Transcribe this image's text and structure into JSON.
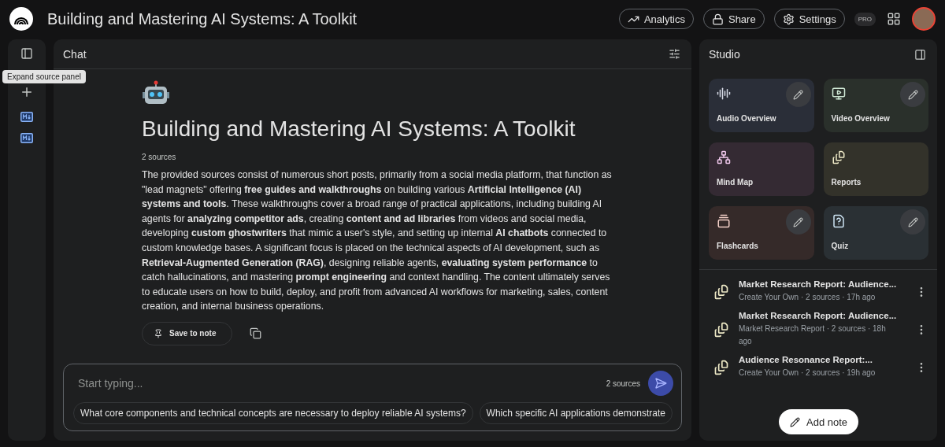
{
  "header": {
    "title": "Building and Mastering AI Systems: A Toolkit",
    "buttons": [
      {
        "label": "Analytics",
        "kind": "analytics"
      },
      {
        "label": "Share",
        "kind": "share"
      },
      {
        "label": "Settings",
        "kind": "settings"
      }
    ],
    "badge": "PRO"
  },
  "sources_rail": {
    "tooltip": "Expand source panel",
    "sources": [
      {
        "kind": "markdown"
      },
      {
        "kind": "markdown"
      }
    ]
  },
  "chat": {
    "title": "Chat",
    "notebook_title": "Building and Mastering AI Systems: A Toolkit",
    "source_count": "2 sources",
    "summary": "The provided sources consist of numerous short posts, primarily from a social media platform, that function as \"lead magnets\" offering **free guides and walkthroughs** on building various **Artificial Intelligence (AI) systems and tools**. These walkthroughs cover a broad range of practical applications, including building AI agents for **analyzing competitor ads**, creating **content and ad libraries** from videos and social media, developing **custom ghostwriters** that mimic a user's style, and setting up internal **AI chatbots** connected to custom knowledge bases. A significant focus is placed on the technical aspects of AI development, such as **Retrieval-Augmented Generation (RAG)**, designing reliable agents, **evaluating system performance** to catch hallucinations, and mastering **prompt engineering** and context handling. The content ultimately serves to educate users on how to build, deploy, and profit from advanced AI workflows for marketing, sales, content creation, and internal business operations.",
    "save_button": "Save to note",
    "input": {
      "placeholder": "Start typing...",
      "source_count": "2 sources"
    },
    "suggestions": [
      "What core components and technical concepts are necessary to deploy reliable AI systems?",
      "Which specific AI applications demonstrate"
    ]
  },
  "studio": {
    "title": "Studio",
    "tools": [
      {
        "label": "Audio Overview",
        "kind": "audio",
        "editable": true,
        "color": "#2a2e38"
      },
      {
        "label": "Video Overview",
        "kind": "video",
        "editable": true,
        "color": "#2a302b"
      },
      {
        "label": "Mind Map",
        "kind": "mindmap",
        "editable": false,
        "color": "#342a33"
      },
      {
        "label": "Reports",
        "kind": "reports",
        "editable": false,
        "color": "#33322a"
      },
      {
        "label": "Flashcards",
        "kind": "flashcards",
        "editable": true,
        "color": "#352a29"
      },
      {
        "label": "Quiz",
        "kind": "quiz",
        "editable": true,
        "color": "#2a3034"
      }
    ],
    "notes": [
      {
        "title": "Market Research Report: Audience...",
        "meta": "Create Your Own · 2 sources · 17h ago"
      },
      {
        "title": "Market Research Report: Audience...",
        "meta": "Market Research Report · 2 sources · 18h ago"
      },
      {
        "title": "Audience Resonance Report:...",
        "meta": "Create Your Own · 2 sources · 19h ago"
      }
    ],
    "add_note": "Add note"
  }
}
